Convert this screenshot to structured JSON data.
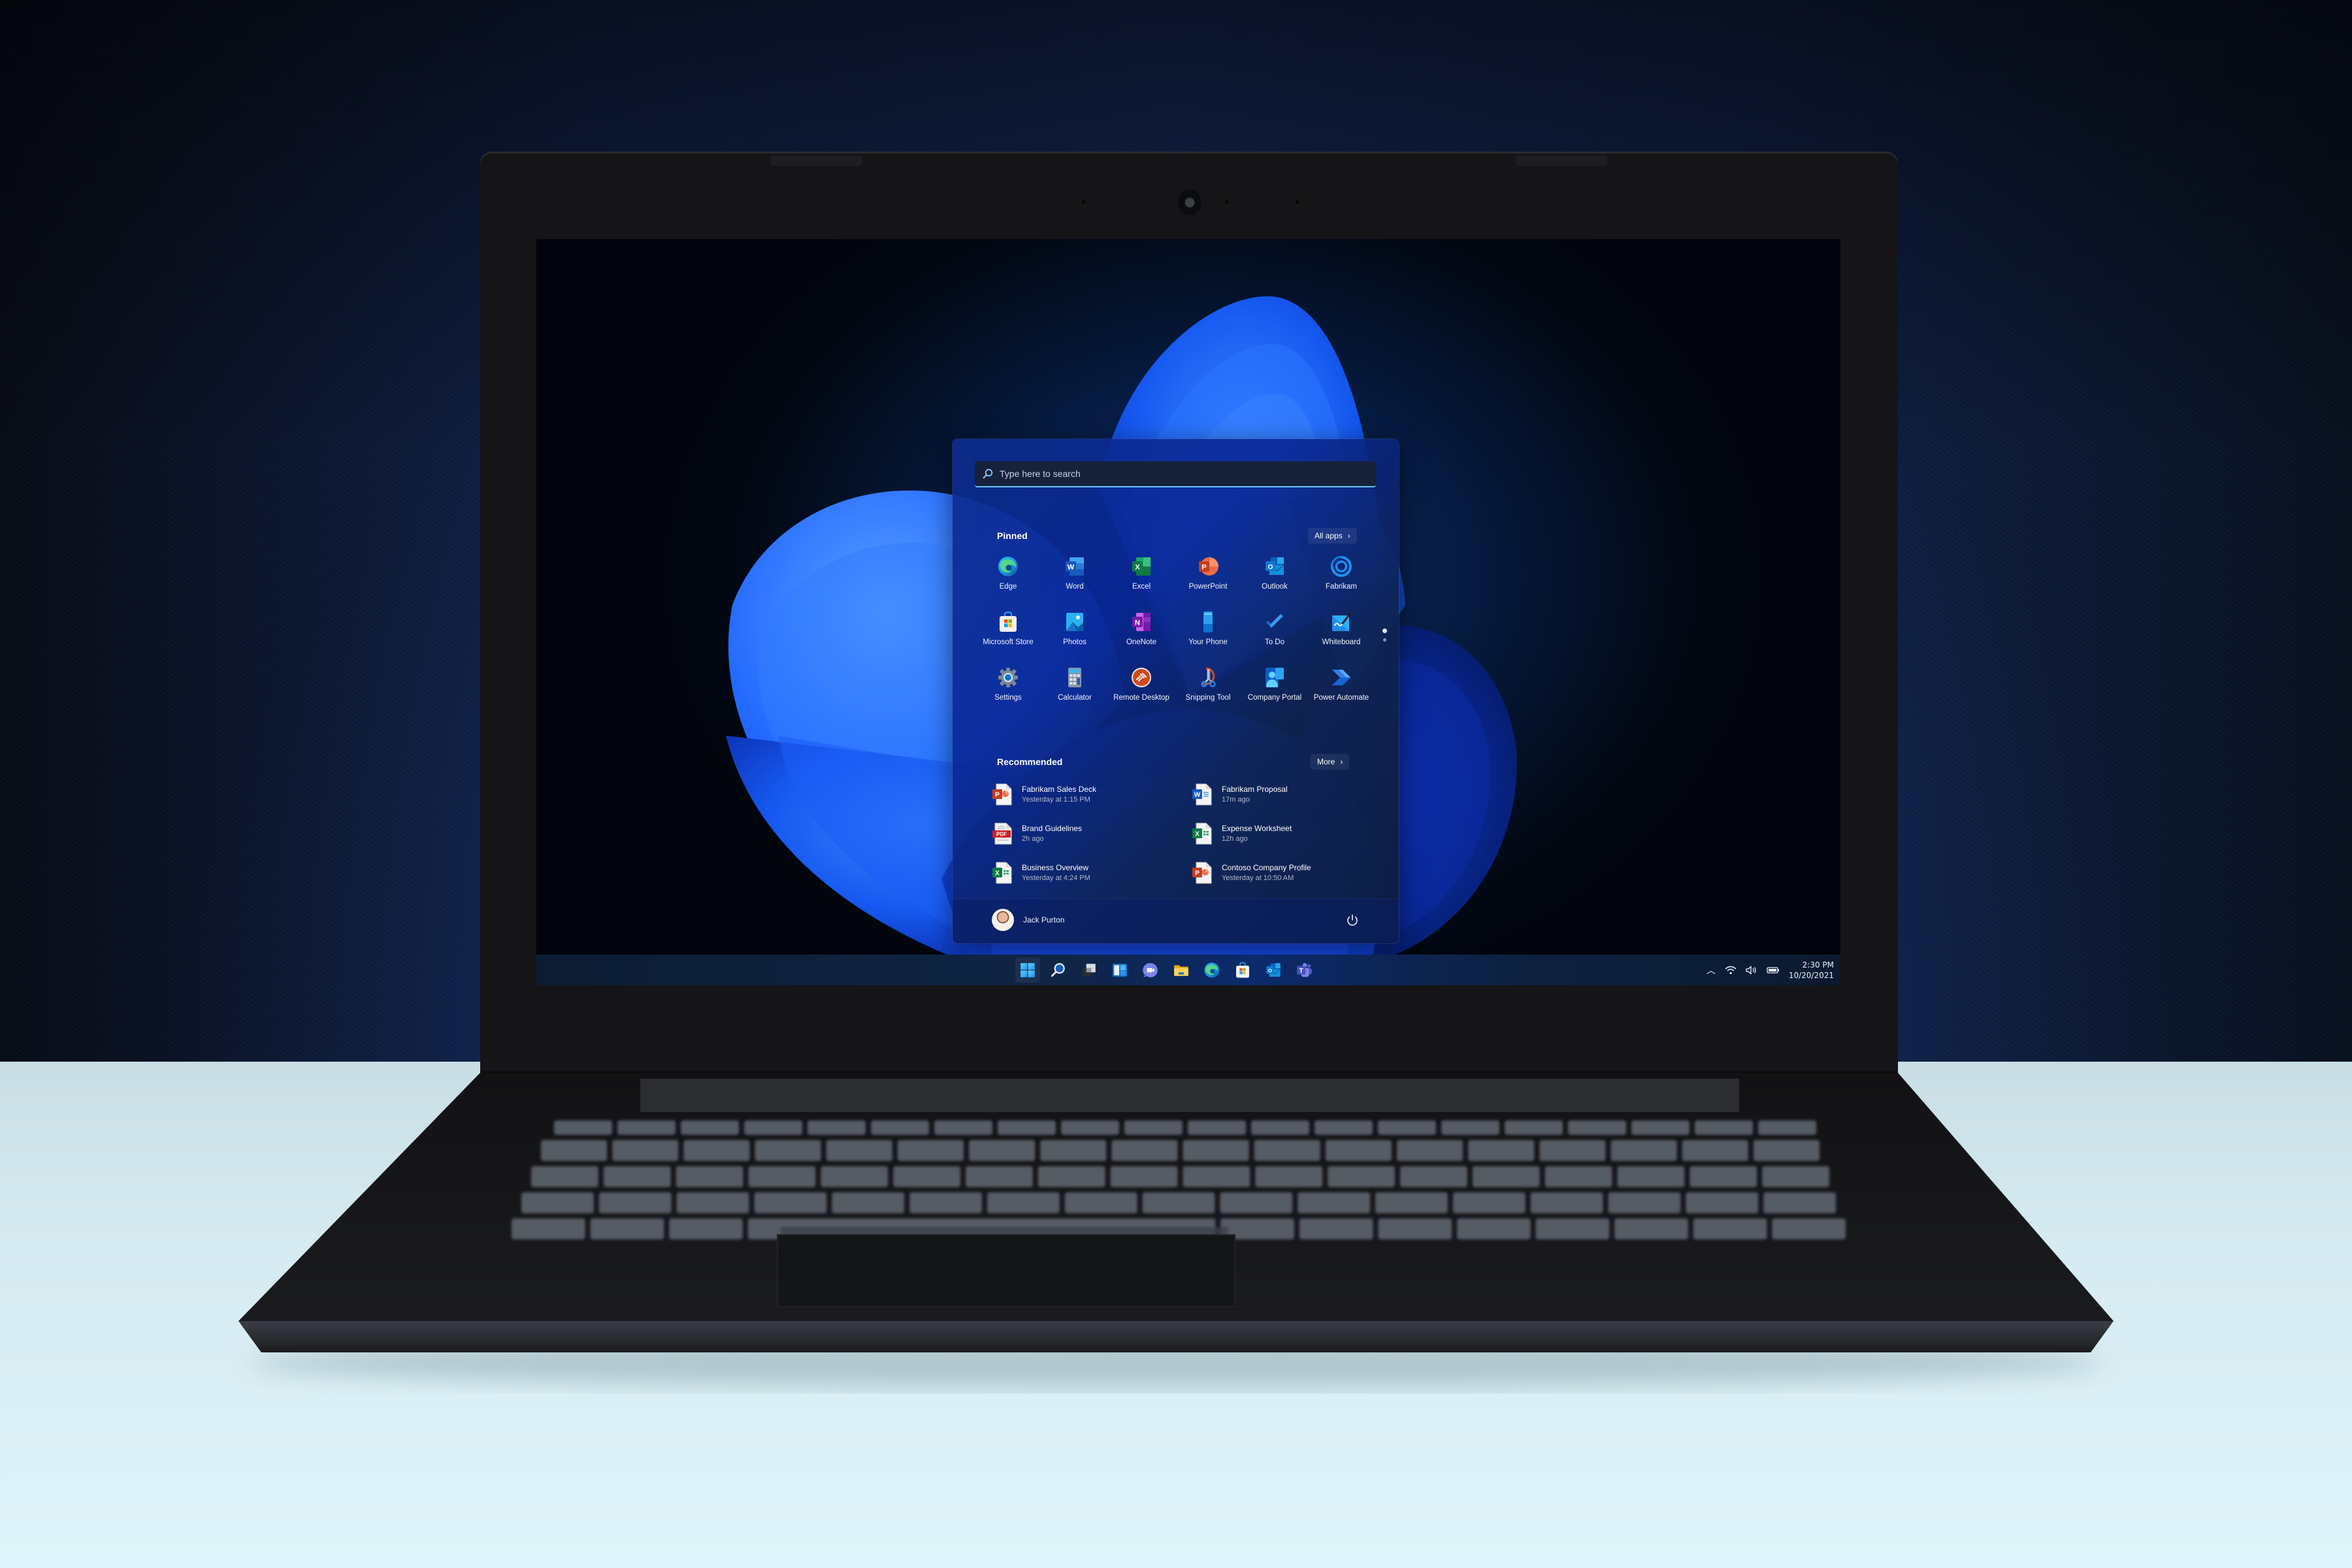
{
  "scene": {
    "description": "Laptop on desk showing Windows 11 Start menu",
    "wall_color": "#14295a",
    "desk_color": "#d6eaf1",
    "laptop_color": "#151517"
  },
  "start_menu": {
    "search": {
      "placeholder": "Type here to search",
      "value": ""
    },
    "pinned": {
      "title": "Pinned",
      "all_apps_label": "All apps",
      "apps": [
        {
          "label": "Edge",
          "icon": "edge-icon"
        },
        {
          "label": "Word",
          "icon": "word-icon"
        },
        {
          "label": "Excel",
          "icon": "excel-icon"
        },
        {
          "label": "PowerPoint",
          "icon": "powerpoint-icon"
        },
        {
          "label": "Outlook",
          "icon": "outlook-icon"
        },
        {
          "label": "Fabrikam",
          "icon": "fabrikam-icon"
        },
        {
          "label": "Microsoft Store",
          "icon": "microsoft-store-icon"
        },
        {
          "label": "Photos",
          "icon": "photos-icon"
        },
        {
          "label": "OneNote",
          "icon": "onenote-icon"
        },
        {
          "label": "Your Phone",
          "icon": "your-phone-icon"
        },
        {
          "label": "To Do",
          "icon": "todo-icon"
        },
        {
          "label": "Whiteboard",
          "icon": "whiteboard-icon"
        },
        {
          "label": "Settings",
          "icon": "settings-icon"
        },
        {
          "label": "Calculator",
          "icon": "calculator-icon"
        },
        {
          "label": "Remote Desktop",
          "icon": "remote-desktop-icon"
        },
        {
          "label": "Snipping Tool",
          "icon": "snipping-tool-icon"
        },
        {
          "label": "Company Portal",
          "icon": "company-portal-icon"
        },
        {
          "label": "Power Automate",
          "icon": "power-automate-icon"
        }
      ],
      "page_indicator": {
        "current": 1,
        "total": 2
      }
    },
    "recommended": {
      "title": "Recommended",
      "more_label": "More",
      "items": [
        {
          "title": "Fabrikam Sales Deck",
          "subtitle": "Yesterday at 1:15 PM",
          "icon": "powerpoint-file-icon"
        },
        {
          "title": "Fabrikam Proposal",
          "subtitle": "17m ago",
          "icon": "word-file-icon"
        },
        {
          "title": "Brand Guidelines",
          "subtitle": "2h ago",
          "icon": "pdf-file-icon"
        },
        {
          "title": "Expense Worksheet",
          "subtitle": "12h ago",
          "icon": "excel-file-icon"
        },
        {
          "title": "Business Overview",
          "subtitle": "Yesterday at 4:24 PM",
          "icon": "excel-file-icon"
        },
        {
          "title": "Contoso Company Profile",
          "subtitle": "Yesterday at 10:50 AM",
          "icon": "powerpoint-file-icon"
        }
      ]
    },
    "user": {
      "name": "Jack Purton"
    },
    "power_icon": "power-icon"
  },
  "taskbar": {
    "apps": [
      {
        "name": "start",
        "icon": "windows-start-icon",
        "active": true
      },
      {
        "name": "search",
        "icon": "search-icon"
      },
      {
        "name": "task-view",
        "icon": "task-view-icon"
      },
      {
        "name": "widgets",
        "icon": "widgets-icon"
      },
      {
        "name": "chat",
        "icon": "teams-chat-icon"
      },
      {
        "name": "file-explorer",
        "icon": "file-explorer-icon"
      },
      {
        "name": "edge",
        "icon": "edge-icon"
      },
      {
        "name": "microsoft-store",
        "icon": "microsoft-store-icon"
      },
      {
        "name": "outlook",
        "icon": "outlook-icon"
      },
      {
        "name": "teams",
        "icon": "teams-icon"
      }
    ],
    "tray": {
      "overflow_icon": "chevron-up-icon",
      "wifi_icon": "wifi-icon",
      "volume_icon": "volume-icon",
      "battery_icon": "battery-icon",
      "time": "2:30 PM",
      "date": "10/20/2021"
    }
  },
  "colors": {
    "accent": "#6cc4f4",
    "start_bg": "#0c2d8c",
    "taskbar_bg": "#0f2545"
  }
}
